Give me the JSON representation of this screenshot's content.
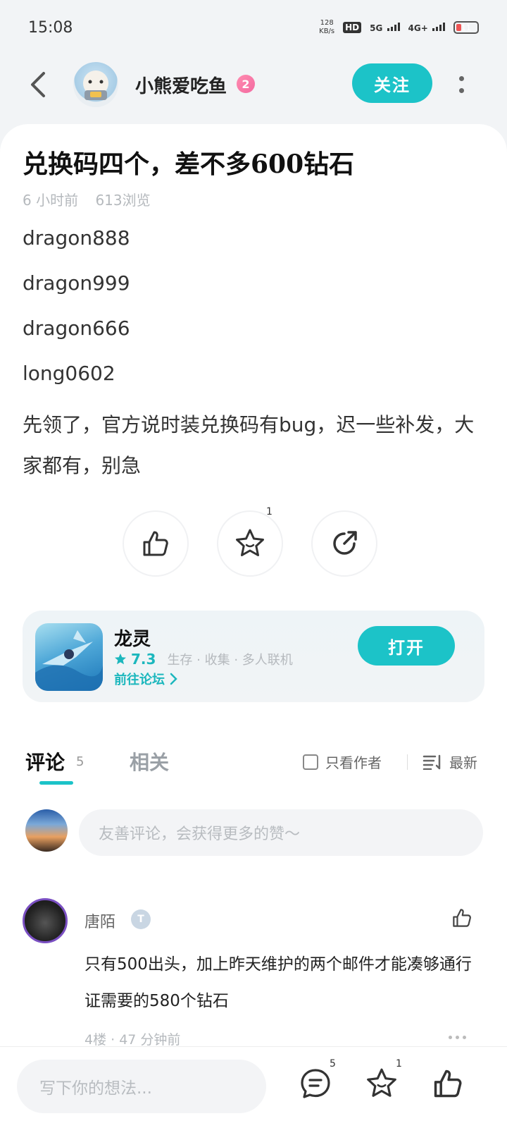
{
  "status_bar": {
    "time": "15:08",
    "net_speed_value": "128",
    "net_speed_unit": "KB/s",
    "hd": "HD",
    "sim_labels": [
      "5G",
      "4G+"
    ],
    "battery": "11"
  },
  "header": {
    "author_name": "小熊爱吃鱼",
    "author_level": "2",
    "follow_label": "关注"
  },
  "post": {
    "title": "兑换码四个，差不多600钻石",
    "time_ago": "6 小时前",
    "views": "613浏览",
    "codes": [
      "dragon888",
      "dragon999",
      "dragon666",
      "long0602"
    ],
    "paragraph": "先领了，官方说时装兑换码有bug，迟一些补发，大家都有，别急",
    "favorite_count": "1"
  },
  "game": {
    "name": "龙灵",
    "rating": "7.3",
    "tags": "生存 · 收集 · 多人联机",
    "forum_link": "前往论坛",
    "open_label": "打开"
  },
  "comments_section": {
    "tab_comments": "评论",
    "comment_count": "5",
    "tab_related": "相关",
    "only_author": "只看作者",
    "sort_label": "最新",
    "input_placeholder": "友善评论，会获得更多的赞～",
    "items": [
      {
        "author": "唐陌",
        "badge": "T",
        "text": "只有500出头，加上昨天维护的两个邮件才能凑够通行证需要的580个钻石",
        "meta": "4楼 · 47 分钟前"
      }
    ]
  },
  "bottom_bar": {
    "placeholder": "写下你的想法...",
    "comment_count": "5",
    "favorite_count": "1"
  },
  "colors": {
    "accent": "#1cc3c8",
    "level_badge": "#f36aa0",
    "background": "#f2f4f6"
  }
}
